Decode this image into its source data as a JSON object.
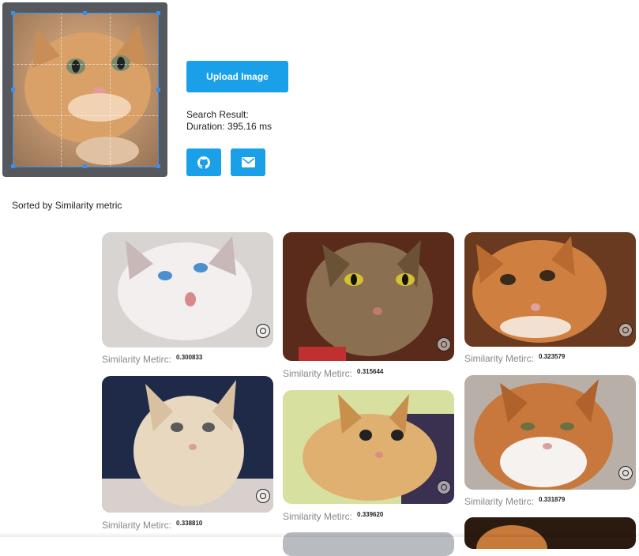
{
  "upload": {
    "label": "Upload Image"
  },
  "result": {
    "heading": "Search Result:",
    "duration": "Duration: 395.16 ms"
  },
  "sort": {
    "label": "Sorted by Similarity metric"
  },
  "icons": {
    "github": "github-icon",
    "email": "envelope-icon",
    "zoom": "zoom-in-icon"
  },
  "colors": {
    "accent": "#1aa0e8",
    "crop_border": "#3b8df0",
    "editor_bg": "#55585c"
  },
  "metric_label": "Similarity Metirc:",
  "results": [
    {
      "score": "0.300833"
    },
    {
      "score": "0.315644"
    },
    {
      "score": "0.323579"
    },
    {
      "score": "0.338810"
    },
    {
      "score": "0.339620"
    },
    {
      "score": "0.331879"
    }
  ]
}
